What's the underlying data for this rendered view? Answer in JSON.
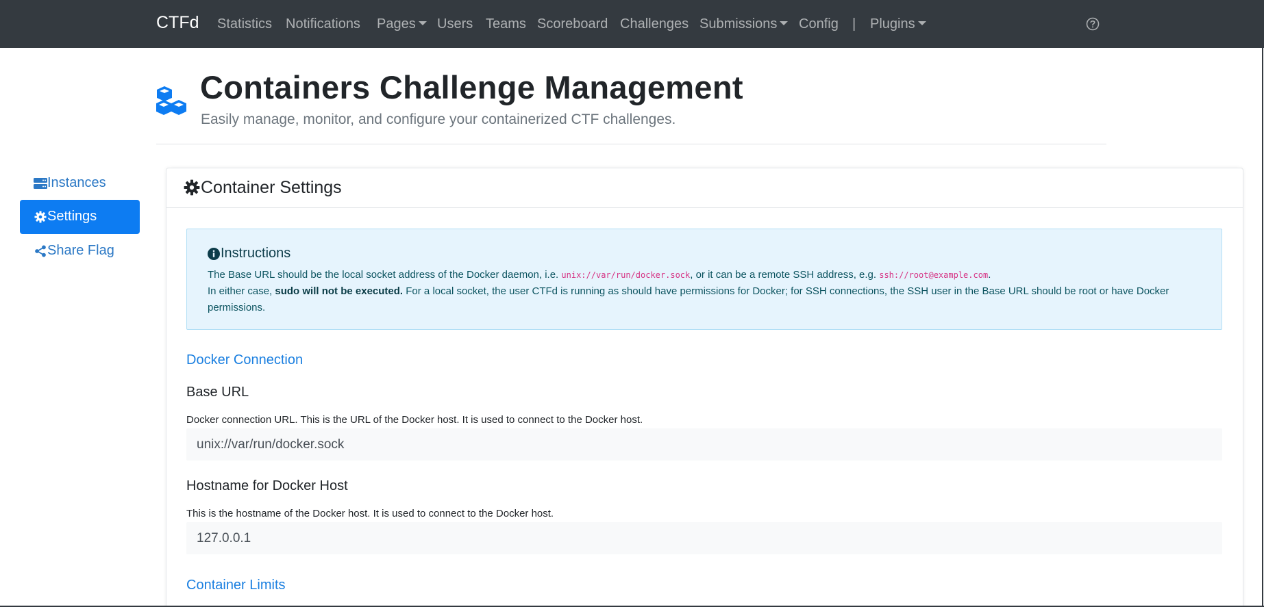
{
  "navbar": {
    "brand": "CTFd",
    "items": [
      {
        "label": "Statistics"
      },
      {
        "label": "Notifications"
      },
      {
        "label": "Pages"
      },
      {
        "label": "Users"
      },
      {
        "label": "Teams"
      },
      {
        "label": "Scoreboard"
      },
      {
        "label": "Challenges"
      },
      {
        "label": "Submissions"
      },
      {
        "label": "Config"
      },
      {
        "label": "|"
      },
      {
        "label": "Plugins"
      }
    ],
    "help_icon": "question-circle-icon"
  },
  "header": {
    "title": "Containers Challenge Management",
    "subtitle": "Easily manage, monitor, and configure your containerized CTF challenges.",
    "icon": "cubes-icon",
    "icon_color": "#0d7cf2"
  },
  "sidebar": {
    "items": [
      {
        "label": "Instances",
        "icon": "server-icon",
        "active": false
      },
      {
        "label": "Settings",
        "icon": "gear-icon",
        "active": true
      },
      {
        "label": "Share Flag",
        "icon": "share-icon",
        "active": false
      }
    ],
    "active_color": "#0d7cf2",
    "link_color": "#2b78c5"
  },
  "settings": {
    "card_title": "Container Settings",
    "instructions": {
      "title": "Instructions",
      "line1_pre": "The Base URL should be the local socket address of the Docker daemon, i.e. ",
      "line1_code1": "unix://var/run/docker.sock",
      "line1_mid": ", or it can be a remote SSH address, e.g. ",
      "line1_code2": "ssh://root@example.com",
      "line1_post": ".",
      "line2_pre": "In either case, ",
      "line2_bold": "sudo will not be executed.",
      "line2_post": " For a local socket, the user CTFd is running as should have permissions for Docker; for SSH connections, the SSH user in the Base URL should be root or have Docker",
      "line3": "permissions."
    },
    "docker_connection": {
      "section_title": "Docker Connection",
      "base_url": {
        "label": "Base URL",
        "help": "Docker connection URL. This is the URL of the Docker host. It is used to connect to the Docker host.",
        "value": "unix://var/run/docker.sock"
      },
      "hostname": {
        "label": "Hostname for Docker Host",
        "help": "This is the hostname of the Docker host. It is used to connect to the Docker host.",
        "value": "127.0.0.1"
      }
    },
    "container_limits": {
      "section_title": "Container Limits"
    }
  }
}
